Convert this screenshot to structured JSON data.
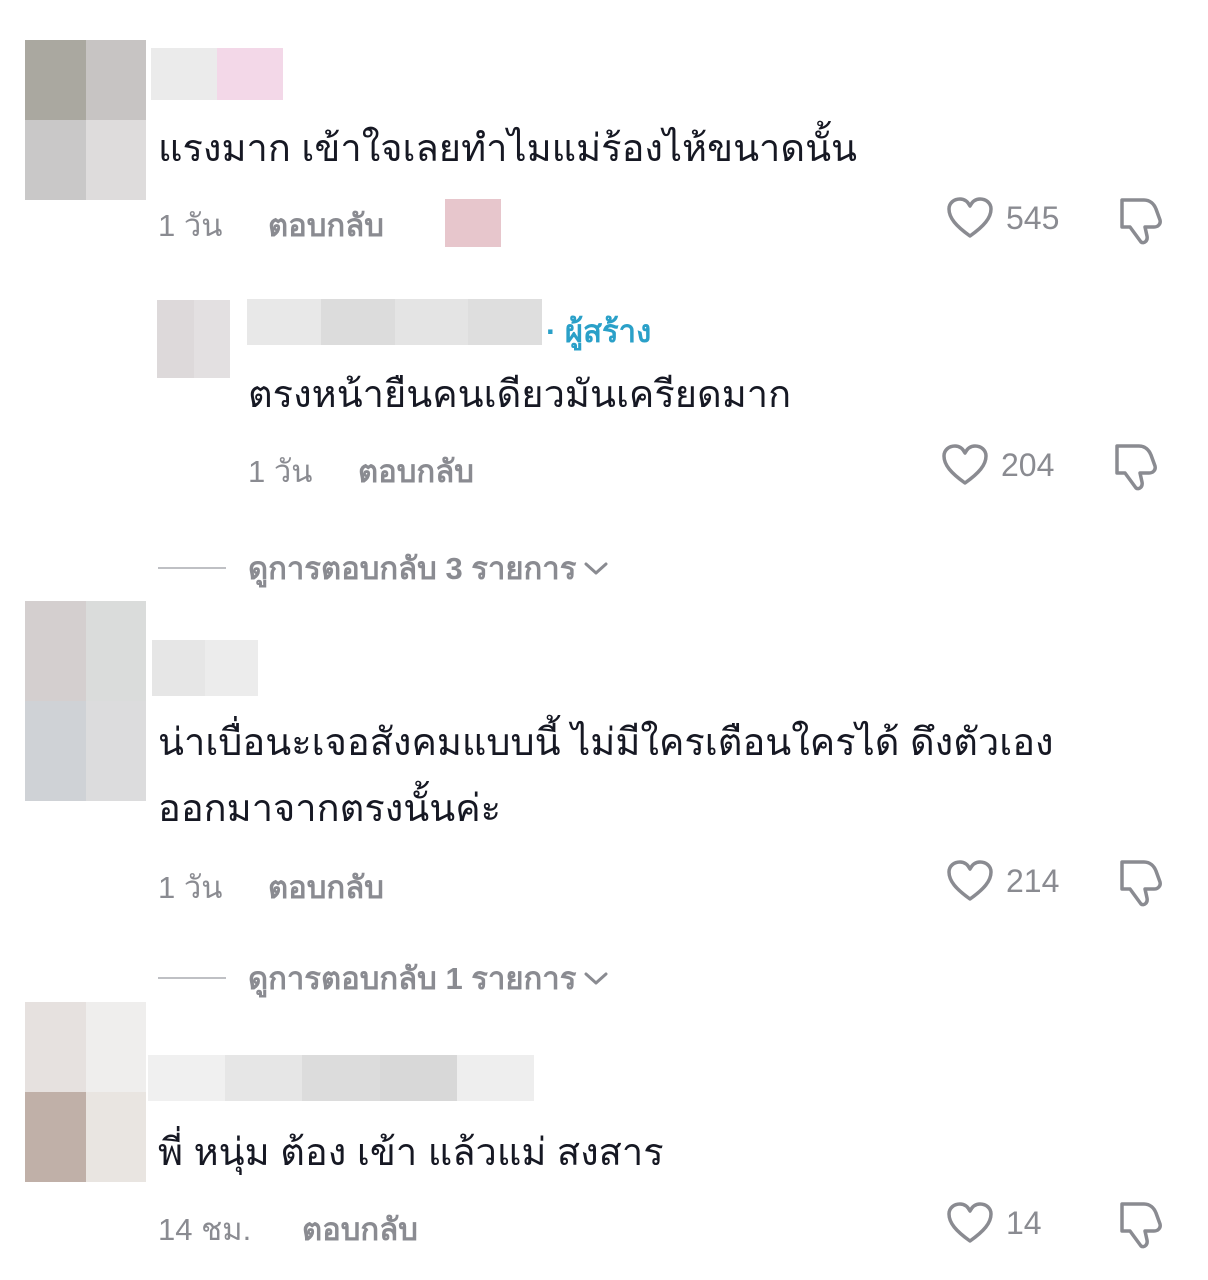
{
  "comments": [
    {
      "text": "แรงมาก เข้าใจเลยทำไมแม่ร้องไห้ขนาดนั้น",
      "time": "1 วัน",
      "reply_label": "ตอบกลับ",
      "likes": "545"
    },
    {
      "creator_badge": "· ผู้สร้าง",
      "text": "ตรงหน้ายืนคนเดียวมันเครียดมาก",
      "time": "1 วัน",
      "reply_label": "ตอบกลับ",
      "likes": "204"
    },
    {
      "text_line1": "น่าเบื่อนะเจอสังคมแบบนี้ ไม่มีใครเตือนใครได้ ดึงตัวเอง",
      "text_line2": "ออกมาจากตรงนั้นค่ะ",
      "time": "1 วัน",
      "reply_label": "ตอบกลับ",
      "likes": "214"
    },
    {
      "text": "พี่ หนุ่ม ต้อง เข้า แล้วแม่ สงสาร",
      "time": "14 ชม.",
      "reply_label": "ตอบกลับ",
      "likes": "14"
    }
  ],
  "view_more": [
    {
      "label": "ดูการตอบกลับ 3 รายการ"
    },
    {
      "label": "ดูการตอบกลับ 1 รายการ"
    }
  ],
  "colors": {
    "text": "#161823",
    "muted": "#8a8b91",
    "creator_accent": "#2aa0c8"
  },
  "icons": [
    "heart-icon",
    "dislike-icon",
    "chevron-down-icon"
  ]
}
